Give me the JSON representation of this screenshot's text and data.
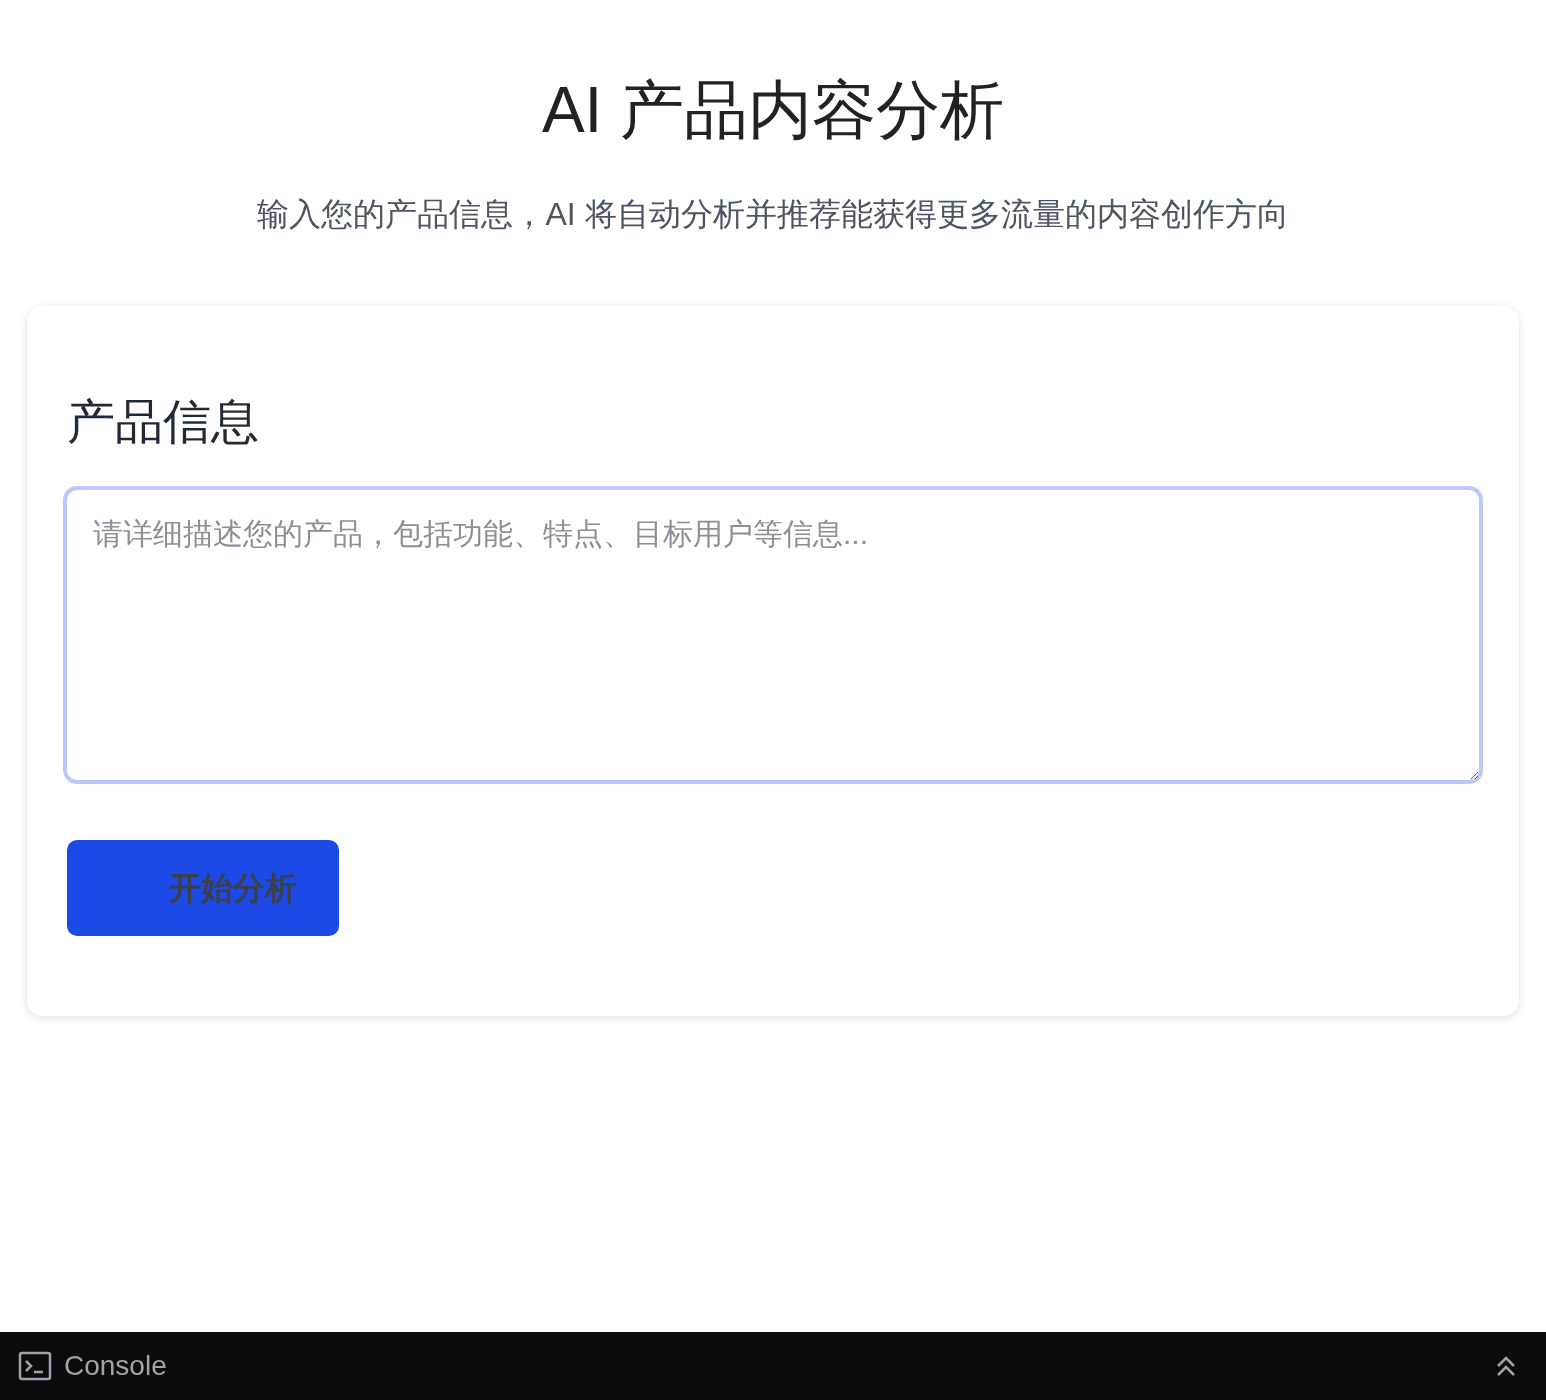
{
  "header": {
    "title": "AI 产品内容分析",
    "subtitle": "输入您的产品信息，AI 将自动分析并推荐能获得更多流量的内容创作方向"
  },
  "card": {
    "heading": "产品信息",
    "textarea": {
      "placeholder": "请详细描述您的产品，包括功能、特点、目标用户等信息...",
      "focused": true
    },
    "button": "开始分析"
  },
  "console_bar": {
    "label": "Console"
  }
}
